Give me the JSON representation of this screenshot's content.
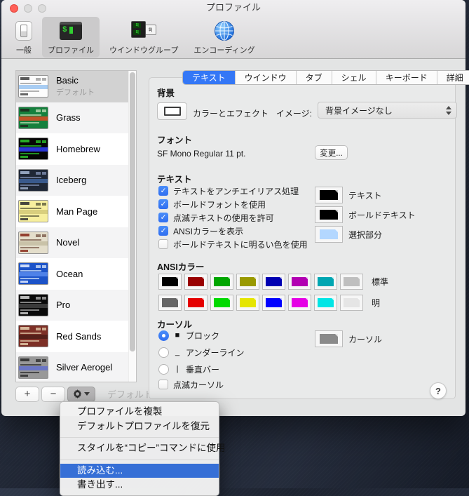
{
  "window": {
    "title": "プロファイル"
  },
  "toolbar": {
    "items": [
      {
        "id": "general",
        "label": "一般",
        "icon": "toggle-switch-icon",
        "selected": false
      },
      {
        "id": "profiles",
        "label": "プロファイル",
        "icon": "terminal-icon",
        "selected": true
      },
      {
        "id": "window-groups",
        "label": "ウインドウグループ",
        "icon": "window-groups-icon",
        "selected": false
      },
      {
        "id": "encodings",
        "label": "エンコーディング",
        "icon": "globe-icon",
        "selected": false
      }
    ]
  },
  "profiles": {
    "list": [
      {
        "name": "Basic",
        "subtitle": "デフォルト",
        "selected": true,
        "thumb": {
          "bg": "#fcfcfc",
          "ink": "#9a9a9a",
          "band": "#a9cdf3",
          "chip": "#4a4a4a"
        }
      },
      {
        "name": "Grass",
        "thumb": {
          "bg": "#15803d",
          "ink": "#bcd9b2",
          "band": "#bf5226",
          "chip": "#1e2a1e"
        }
      },
      {
        "name": "Homebrew",
        "thumb": {
          "bg": "#060606",
          "ink": "#2bbf2b",
          "band": "#2936d6",
          "chip": "#2bbf2b"
        }
      },
      {
        "name": "Iceberg",
        "thumb": {
          "bg": "#1f2736",
          "ink": "#7e8eb2",
          "band": "#39598c",
          "chip": "#9fb0cc"
        }
      },
      {
        "name": "Man Page",
        "thumb": {
          "bg": "#f7ef9e",
          "ink": "#5a5a3a",
          "band": "#d9cf7e",
          "chip": "#333333"
        }
      },
      {
        "name": "Novel",
        "thumb": {
          "bg": "#e4decb",
          "ink": "#7a5a4a",
          "band": "#c9c2a8",
          "chip": "#8b2f1f"
        }
      },
      {
        "name": "Ocean",
        "thumb": {
          "bg": "#1c53c8",
          "ink": "#cfe0f8",
          "band": "#4f82e8",
          "chip": "#dfeaff"
        }
      },
      {
        "name": "Pro",
        "thumb": {
          "bg": "#0a0a0a",
          "ink": "#ababab",
          "band": "#3a3a3a",
          "chip": "#cccccc"
        }
      },
      {
        "name": "Red Sands",
        "thumb": {
          "bg": "#7d2f26",
          "ink": "#e0c8a8",
          "band": "#55201a",
          "chip": "#e0c8a8"
        }
      },
      {
        "name": "Silver Aerogel",
        "thumb": {
          "bg": "#989898",
          "ink": "#2e2e2e",
          "band": "#6b76c4",
          "chip": "#2e2e2e"
        }
      }
    ],
    "buttons": {
      "add": "+",
      "remove": "−",
      "default_label": "デフォルト"
    }
  },
  "tabs": {
    "items": [
      "テキスト",
      "ウインドウ",
      "タブ",
      "シェル",
      "キーボード",
      "詳細"
    ],
    "selected_index": 0
  },
  "sections": {
    "background": {
      "title": "背景",
      "color_button_label": "カラーとエフェクト",
      "image_label": "イメージ:",
      "image_value": "背景イメージなし"
    },
    "font": {
      "title": "フォント",
      "value": "SF Mono Regular 11 pt.",
      "change_button": "変更..."
    },
    "text": {
      "title": "テキスト",
      "checkboxes": [
        {
          "label": "テキストをアンチエイリアス処理",
          "checked": true
        },
        {
          "label": "ボールドフォントを使用",
          "checked": true
        },
        {
          "label": "点滅テキストの使用を許可",
          "checked": true
        },
        {
          "label": "ANSIカラーを表示",
          "checked": true
        },
        {
          "label": "ボールドテキストに明るい色を使用",
          "checked": false
        }
      ],
      "wells": [
        {
          "label": "テキスト",
          "color": "#000000"
        },
        {
          "label": "ボールドテキスト",
          "color": "#000000"
        },
        {
          "label": "選択部分",
          "color": "#b3d7ff"
        }
      ]
    },
    "ansi": {
      "title": "ANSIカラー",
      "rows": [
        {
          "label": "標準",
          "colors": [
            "#000000",
            "#990000",
            "#00a600",
            "#999900",
            "#0000b2",
            "#b200b2",
            "#00a6b2",
            "#bfbfbf"
          ]
        },
        {
          "label": "明",
          "colors": [
            "#666666",
            "#e50000",
            "#00d900",
            "#e5e500",
            "#0000ff",
            "#e500e5",
            "#00e5e5",
            "#e5e5e5"
          ]
        }
      ]
    },
    "cursor": {
      "title": "カーソル",
      "radios": [
        {
          "label": "ブロック",
          "glyph": "■",
          "selected": true
        },
        {
          "label": "アンダーライン",
          "glyph": "_",
          "selected": false
        },
        {
          "label": "垂直バー",
          "glyph": "|",
          "selected": false
        }
      ],
      "blink": {
        "label": "点滅カーソル",
        "checked": false
      },
      "well": {
        "label": "カーソル",
        "color": "#8a8a8a"
      }
    }
  },
  "help": {
    "label": "?"
  },
  "menu": {
    "items": [
      {
        "type": "item",
        "label": "プロファイルを複製",
        "highlighted": false
      },
      {
        "type": "item",
        "label": "デフォルトプロファイルを復元",
        "highlighted": false
      },
      {
        "type": "separator"
      },
      {
        "type": "item",
        "label": "スタイルを“コピー”コマンドに使用",
        "highlighted": false
      },
      {
        "type": "separator"
      },
      {
        "type": "item",
        "label": "読み込む...",
        "highlighted": true
      },
      {
        "type": "item",
        "label": "書き出す...",
        "highlighted": false
      }
    ]
  },
  "colors": {
    "accent": "#3477f6",
    "menu_highlight": "#366fd6",
    "selected_row": "#d2d2d2"
  }
}
